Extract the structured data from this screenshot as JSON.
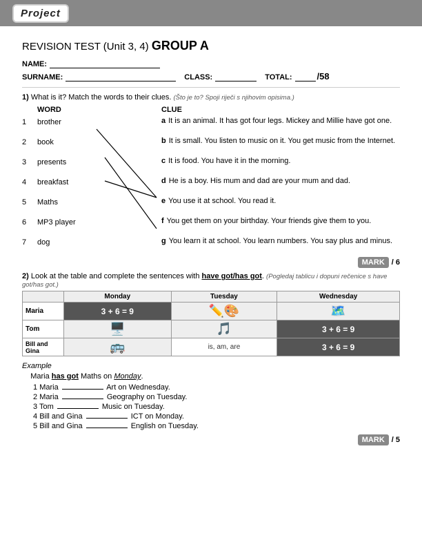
{
  "header": {
    "logo_text": "Project"
  },
  "test": {
    "title_regular": "REVISION TEST (Unit 3, 4)",
    "title_bold": "GROUP A",
    "name_label": "NAME:",
    "surname_label": "SURNAME:",
    "class_label": "CLASS:",
    "total_label": "TOTAL:",
    "total_score": "/58"
  },
  "section1": {
    "number": "1)",
    "instruction": "What is it? Match the words to their clues.",
    "instruction_native": "(Što je to? Spoji riječi s njihovim opisima.)",
    "word_header": "WORD",
    "clue_header": "CLUE",
    "words": [
      {
        "num": "1",
        "word": "brother"
      },
      {
        "num": "2",
        "word": "book"
      },
      {
        "num": "3",
        "word": "presents"
      },
      {
        "num": "4",
        "word": "breakfast"
      },
      {
        "num": "5",
        "word": "Maths"
      },
      {
        "num": "6",
        "word": "MP3 player"
      },
      {
        "num": "7",
        "word": "dog"
      }
    ],
    "clues": [
      {
        "letter": "a",
        "text": "It is an animal. It has got four legs. Mickey and Millie have got one."
      },
      {
        "letter": "b",
        "text": "It is small. You listen to music on it. You get music from the Internet."
      },
      {
        "letter": "c",
        "text": "It is food. You have it in the morning."
      },
      {
        "letter": "d",
        "text": "He is a boy. His mum and dad are your mum and dad."
      },
      {
        "letter": "e",
        "text": "You use it at school. You read it."
      },
      {
        "letter": "f",
        "text": "You get them on your birthday. Your friends give them to you."
      },
      {
        "letter": "g",
        "text": "You learn it at school. You learn numbers. You say plus and minus."
      }
    ],
    "mark_label": "MARK",
    "mark_score": "/ 6"
  },
  "section2": {
    "number": "2)",
    "instruction": "Look at the table and complete the sentences with",
    "have_got": "have got/has got",
    "instruction_native": "(Pogledaj tablicu i dopuni rečenice s have got/has got.)",
    "table": {
      "headers": [
        "",
        "Monday",
        "Tuesday",
        "Wednesday"
      ],
      "rows": [
        {
          "name": "Maria",
          "monday": "3 + 6 = 9",
          "tuesday": "🎨",
          "wednesday": "✏️"
        },
        {
          "name": "Tom",
          "monday": "🖥️",
          "tuesday": "🎵",
          "wednesday": "3 + 6 = 9"
        },
        {
          "name": "Bill and Gina",
          "monday": "🚌",
          "tuesday": "is, am, are",
          "wednesday": "3 + 6 = 9"
        }
      ]
    },
    "example_label": "Example",
    "example_text_pre": "Maria",
    "example_has_got": "has got",
    "example_subject": "Maths",
    "example_prep": "on",
    "example_day": "Monday",
    "sentences": [
      {
        "num": "1",
        "text": "Maria",
        "blank": true,
        "rest": "Art on Wednesday."
      },
      {
        "num": "2",
        "text": "Maria",
        "blank": true,
        "rest": "Geography on Tuesday."
      },
      {
        "num": "3",
        "text": "Tom",
        "blank": true,
        "rest": "Music on Tuesday."
      },
      {
        "num": "4",
        "text": "Bill and Gina",
        "blank": true,
        "rest": "ICT on Monday."
      },
      {
        "num": "5",
        "text": "Bill and Gina",
        "blank": true,
        "rest": "English on Tuesday."
      }
    ],
    "mark_label": "MARK",
    "mark_score": "/ 5"
  }
}
